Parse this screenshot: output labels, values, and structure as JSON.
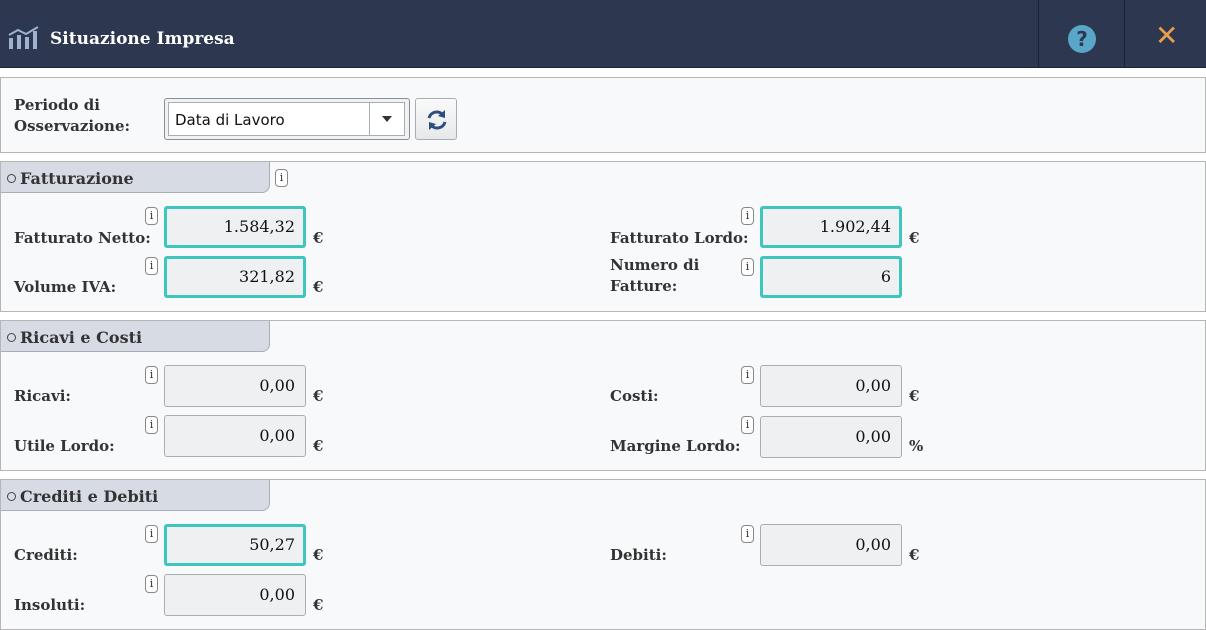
{
  "header": {
    "title": "Situazione Impresa",
    "help_icon": "?",
    "close_icon": "✕"
  },
  "period": {
    "label": "Periodo di Osservazione:",
    "selected": "Data di Lavoro"
  },
  "sections": {
    "fatturazione": {
      "title": "Fatturazione",
      "fatturato_netto": {
        "label": "Fatturato Netto:",
        "value": "1.584,32",
        "unit": "€"
      },
      "fatturato_lordo": {
        "label": "Fatturato Lordo:",
        "value": "1.902,44",
        "unit": "€"
      },
      "volume_iva": {
        "label": "Volume IVA:",
        "value": "321,82",
        "unit": "€"
      },
      "numero_fatture": {
        "label": "Numero di Fatture:",
        "value": "6"
      }
    },
    "ricavi_costi": {
      "title": "Ricavi e Costi",
      "ricavi": {
        "label": "Ricavi:",
        "value": "0,00",
        "unit": "€"
      },
      "costi": {
        "label": "Costi:",
        "value": "0,00",
        "unit": "€"
      },
      "utile_lordo": {
        "label": "Utile Lordo:",
        "value": "0,00",
        "unit": "€"
      },
      "margine_lordo": {
        "label": "Margine Lordo:",
        "value": "0,00",
        "unit": "%"
      }
    },
    "crediti_debiti": {
      "title": "Crediti e Debiti",
      "crediti": {
        "label": "Crediti:",
        "value": "50,27",
        "unit": "€"
      },
      "debiti": {
        "label": "Debiti:",
        "value": "0,00",
        "unit": "€"
      },
      "insoluti": {
        "label": "Insoluti:",
        "value": "0,00",
        "unit": "€"
      }
    }
  },
  "info_glyph": "i",
  "colors": {
    "header_bg": "#2d3850",
    "highlight_border": "#3ec5bd",
    "close_icon": "#e8a04a",
    "help_icon": "#5aa6c8"
  }
}
